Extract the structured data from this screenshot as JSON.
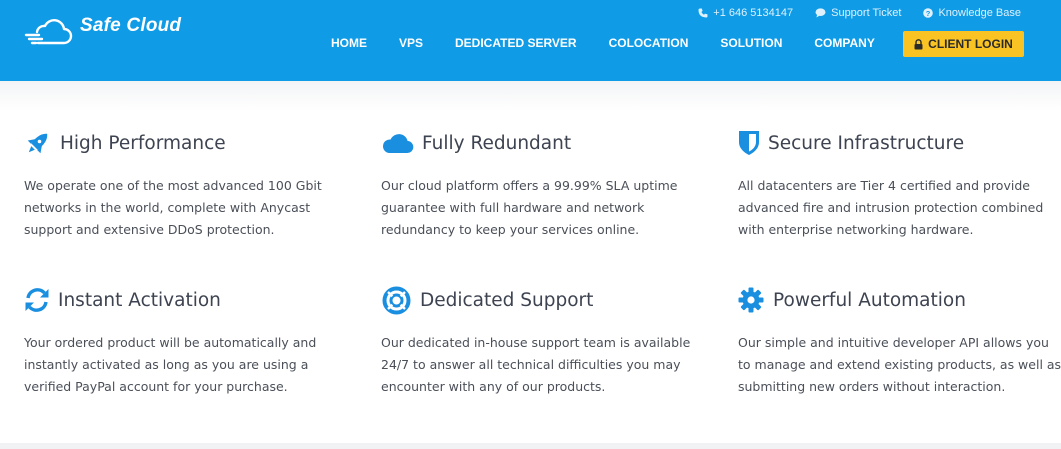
{
  "brand": {
    "name": "Safe Cloud",
    "logo_icon": "cloud-speed-icon"
  },
  "topbar": {
    "phone": "+1 646 5134147",
    "support": "Support Ticket",
    "knowledge": "Knowledge Base"
  },
  "nav": {
    "items": [
      "HOME",
      "VPS",
      "DEDICATED SERVER",
      "COLOCATION",
      "SOLUTION",
      "COMPANY"
    ],
    "login_label": "CLIENT LOGIN"
  },
  "colors": {
    "brand_blue": "#0f9be6",
    "accent_yellow": "#f9c423",
    "icon_blue": "#1a8fe0"
  },
  "features": [
    {
      "icon": "rocket-icon",
      "title": "High Performance",
      "lines": [
        "We operate one of the most advanced 100 Gbit",
        "networks in the world, complete with Anycast",
        "support and extensive DDoS protection."
      ]
    },
    {
      "icon": "cloud-icon",
      "title": "Fully Redundant",
      "lines": [
        "Our cloud platform offers a 99.99% SLA uptime",
        "guarantee with full hardware and network",
        "redundancy to keep your services online."
      ]
    },
    {
      "icon": "shield-icon",
      "title": "Secure Infrastructure",
      "lines": [
        "All datacenters are Tier 4 certified and provide",
        "advanced fire and intrusion protection combined",
        "with enterprise networking hardware."
      ]
    },
    {
      "icon": "refresh-icon",
      "title": "Instant Activation",
      "lines": [
        "Your ordered product will be automatically and",
        "instantly activated as long as you are using a",
        "verified PayPal account for your purchase."
      ]
    },
    {
      "icon": "life-ring-icon",
      "title": "Dedicated Support",
      "lines": [
        "Our dedicated in-house support team is available",
        "24/7 to answer all technical difficulties you may",
        "encounter with any of our products."
      ]
    },
    {
      "icon": "gear-icon",
      "title": "Powerful Automation",
      "lines": [
        "Our simple and intuitive developer API allows you",
        "to manage and extend existing products, as well as",
        "submitting new orders without interaction."
      ]
    }
  ]
}
